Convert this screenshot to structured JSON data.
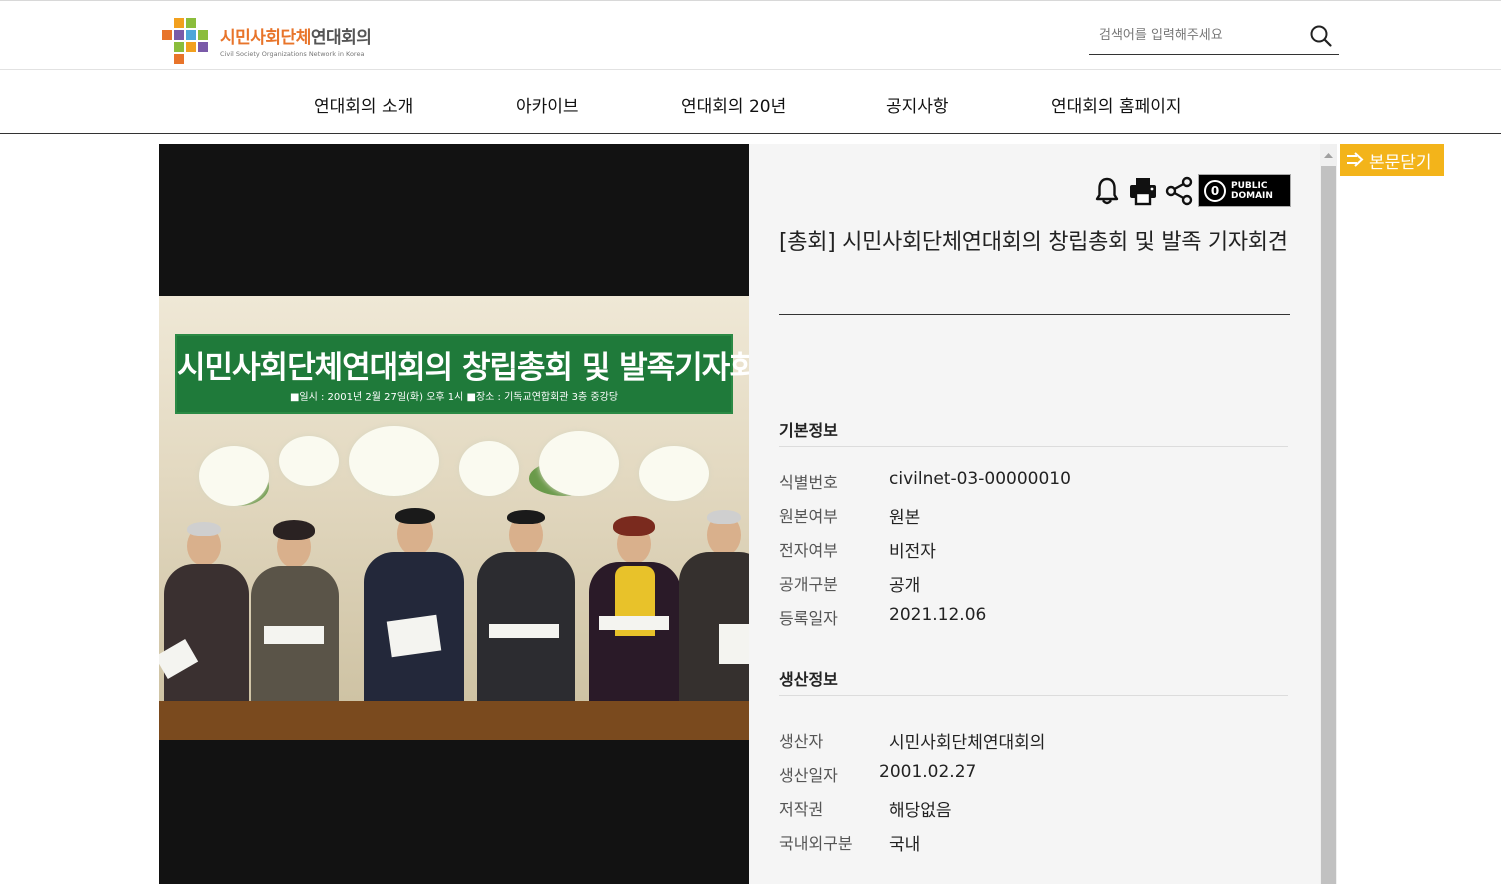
{
  "site": {
    "logo_title_a": "시민사회단체",
    "logo_title_b": "연대회의",
    "logo_subtitle": "Civil Society Organizations Network in Korea"
  },
  "search": {
    "placeholder": "검색어를 입력해주세요",
    "icon": "search-icon"
  },
  "nav": {
    "items": [
      {
        "label": "연대회의 소개"
      },
      {
        "label": "아카이브"
      },
      {
        "label": "연대회의 20년"
      },
      {
        "label": "공지사항"
      },
      {
        "label": "연대회의 홈페이지"
      }
    ]
  },
  "viewer": {
    "banner_title": "시민사회단체연대회의 창립총회 및 발족기자회견",
    "banner_subtitle": "■일시 : 2001년 2월 27일(화) 오후 1시   ■장소 : 기독교연합회관 3층 중강당"
  },
  "toolbar": {
    "icons": [
      "bell-icon",
      "print-icon",
      "share-icon"
    ],
    "license_symbol": "0",
    "license_line1": "PUBLIC",
    "license_line2": "DOMAIN"
  },
  "document": {
    "title": "[총회] 시민사회단체연대회의 창립총회 및 발족 기자회견",
    "basic_info_title": "기본정보",
    "basic_info": [
      {
        "label": "식별번호",
        "value": "civilnet-03-00000010"
      },
      {
        "label": "원본여부",
        "value": "원본"
      },
      {
        "label": "전자여부",
        "value": "비전자"
      },
      {
        "label": "공개구분",
        "value": "공개"
      },
      {
        "label": "등록일자",
        "value": "2021.12.06"
      }
    ],
    "production_info_title": "생산정보",
    "production_info": [
      {
        "label": "생산자",
        "value": "시민사회단체연대회의"
      },
      {
        "label": "생산일자",
        "value": "2001.02.27"
      },
      {
        "label": "저작권",
        "value": "해당없음"
      },
      {
        "label": "국내외구분",
        "value": "국내"
      }
    ]
  },
  "close_button": {
    "label": "본문닫기"
  },
  "colors": {
    "accent": "#f3b41a",
    "logo_orange": "#e8742a",
    "panel_bg": "#f5f5f5",
    "viewer_bg": "#121212"
  }
}
